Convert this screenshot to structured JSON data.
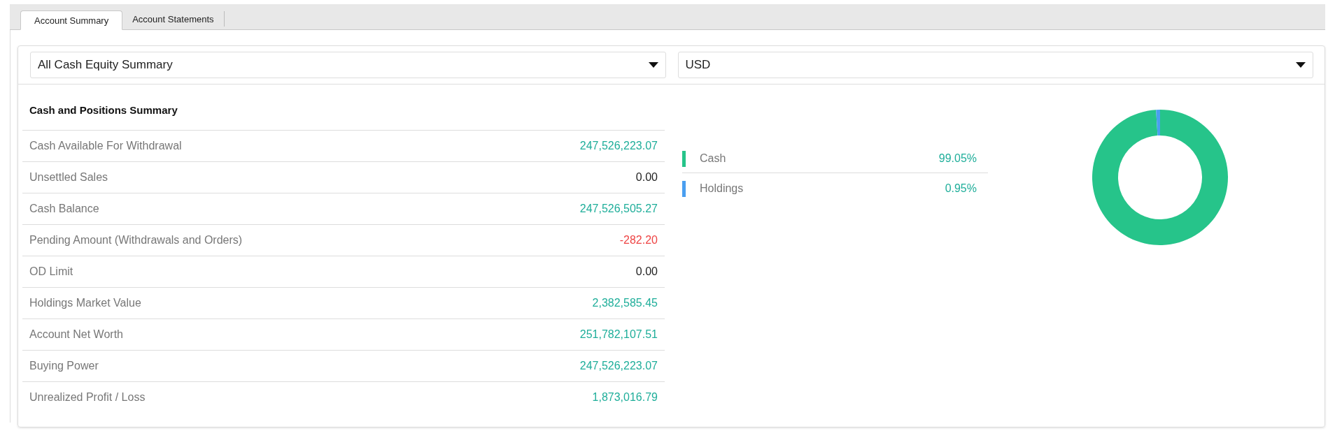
{
  "tabs": [
    {
      "label": "Account Summary",
      "selected": true
    },
    {
      "label": "Account Statements",
      "selected": false
    }
  ],
  "filters": [
    {
      "value": "All Cash Equity Summary"
    },
    {
      "value": "USD"
    }
  ],
  "summary": {
    "title": "Cash and Positions Summary",
    "rows": [
      {
        "label": "Cash Available For Withdrawal",
        "value": "247,526,223.07",
        "kind": "gain"
      },
      {
        "label": "Unsettled Sales",
        "value": "0.00",
        "kind": "zero"
      },
      {
        "label": "Cash Balance",
        "value": "247,526,505.27",
        "kind": "gain"
      },
      {
        "label": "Pending Amount (Withdrawals and Orders)",
        "value": "-282.20",
        "kind": "loss"
      },
      {
        "label": "OD Limit",
        "value": "0.00",
        "kind": "zero"
      },
      {
        "label": "Holdings Market Value",
        "value": "2,382,585.45",
        "kind": "gain"
      },
      {
        "label": "Account Net Worth",
        "value": "251,782,107.51",
        "kind": "gain"
      },
      {
        "label": "Buying Power",
        "value": "247,526,223.07",
        "kind": "gain"
      },
      {
        "label": "Unrealized Profit / Loss",
        "value": "1,873,016.79",
        "kind": "gain"
      }
    ]
  },
  "legend": [
    {
      "value": "99.05%",
      "color": "#26c48a"
    },
    {
      "value": "0.95%",
      "color": "#4a9ff0"
    }
  ],
  "chart_data": {
    "type": "donut",
    "categories": [
      "Cash",
      "Holdings"
    ],
    "values": [
      99.05,
      0.95
    ]
  }
}
